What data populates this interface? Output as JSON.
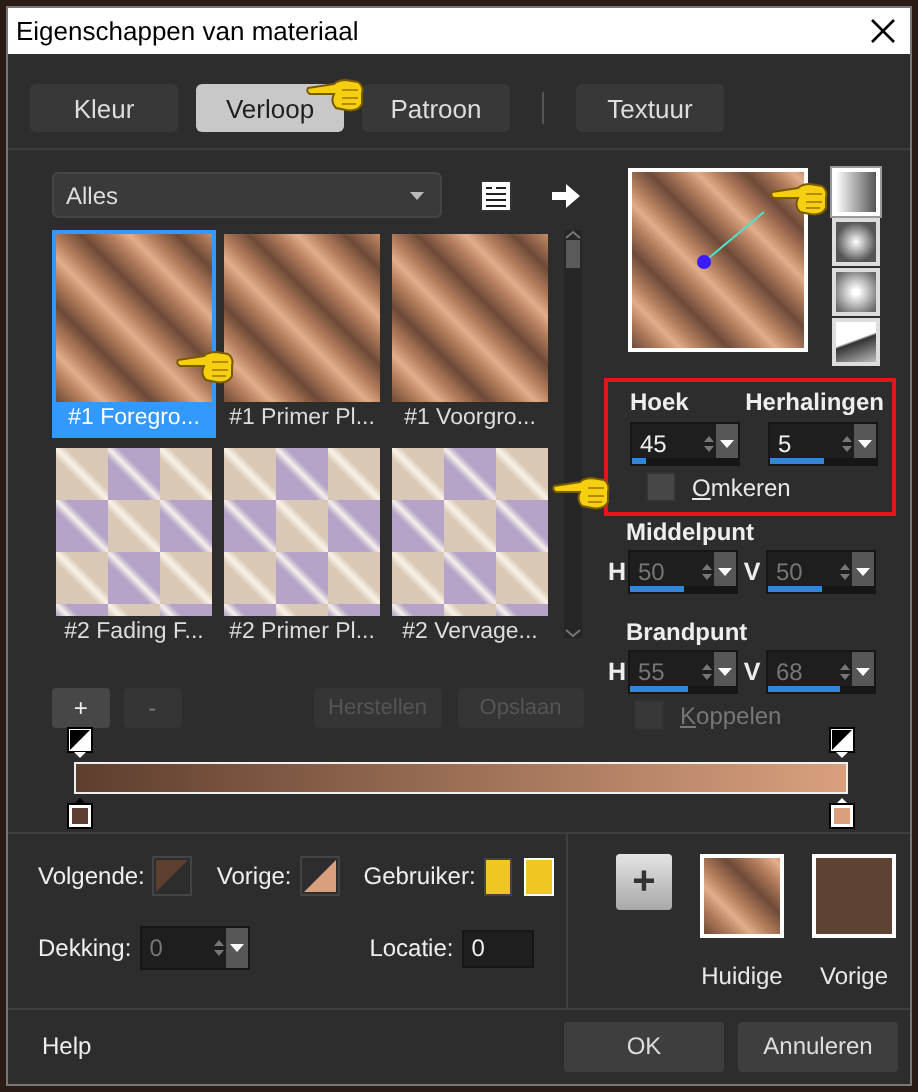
{
  "window": {
    "title": "Eigenschappen van materiaal"
  },
  "tabs": [
    {
      "label": "Kleur",
      "selected": false
    },
    {
      "label": "Verloop",
      "selected": true
    },
    {
      "label": "Patroon",
      "selected": false
    },
    {
      "label": "Textuur",
      "selected": false
    }
  ],
  "library": {
    "category": "Alles",
    "items": [
      {
        "label": "#1 Foregro...",
        "kind": "stripes",
        "selected": true
      },
      {
        "label": "#1 Primer Pl...",
        "kind": "stripes",
        "selected": false
      },
      {
        "label": "#1 Voorgro...",
        "kind": "stripes",
        "selected": false
      },
      {
        "label": "#2 Fading F...",
        "kind": "checker",
        "selected": false
      },
      {
        "label": "#2 Primer Pl...",
        "kind": "checker",
        "selected": false
      },
      {
        "label": "#2 Vervage...",
        "kind": "checker",
        "selected": false
      }
    ]
  },
  "style_buttons": [
    {
      "kind": "linear",
      "selected": true
    },
    {
      "kind": "rectangular",
      "selected": false
    },
    {
      "kind": "sunburst",
      "selected": false
    },
    {
      "kind": "radial",
      "selected": false
    }
  ],
  "angle": {
    "label": "Hoek",
    "value": "45",
    "level": 0.125,
    "disabled": false
  },
  "repeats": {
    "label": "Herhalingen",
    "value": "5",
    "level": 0.5,
    "disabled": false
  },
  "invert": {
    "label": "Omkeren",
    "checked": false,
    "disabled": false
  },
  "center": {
    "label": "Middelpunt",
    "h": {
      "axis": "H",
      "value": "50",
      "level": 0.5,
      "disabled": true
    },
    "v": {
      "axis": "V",
      "value": "50",
      "level": 0.5,
      "disabled": true
    }
  },
  "focal": {
    "label": "Brandpunt",
    "h": {
      "axis": "H",
      "value": "55",
      "level": 0.55,
      "disabled": true
    },
    "v": {
      "axis": "V",
      "value": "68",
      "level": 0.68,
      "disabled": true
    }
  },
  "link": {
    "label": "Koppelen",
    "checked": false,
    "disabled": true
  },
  "stop_buttons": [
    {
      "label": "+",
      "disabled": false
    },
    {
      "label": "-",
      "disabled": true
    }
  ],
  "file_buttons": [
    {
      "label": "Herstellen",
      "disabled": true
    },
    {
      "label": "Opslaan",
      "disabled": true
    }
  ],
  "color_stops": [
    {
      "color": "#5e3e2e",
      "selected": true
    },
    {
      "color": "#d9a07e",
      "selected": false
    }
  ],
  "stop_properties": {
    "next": {
      "label": "Volgende:",
      "color": "#5e3e2e"
    },
    "previous": {
      "label": "Vorige:",
      "color": "#d9a07e"
    },
    "user": {
      "label": "Gebruiker:",
      "colors": [
        {
          "color": "#f2c620",
          "selected": false
        },
        {
          "color": "#f2c620",
          "selected": true
        }
      ]
    },
    "opacity": {
      "label": "Dekking:",
      "value": "0",
      "disabled": true
    },
    "location": {
      "label": "Locatie:",
      "value": "0"
    }
  },
  "add_button": {
    "label": "+"
  },
  "current": {
    "label": "Huidige"
  },
  "previous": {
    "label": "Vorige",
    "color": "#5e4233"
  },
  "footer": {
    "help": "Help",
    "ok": "OK",
    "cancel": "Annuleren"
  }
}
